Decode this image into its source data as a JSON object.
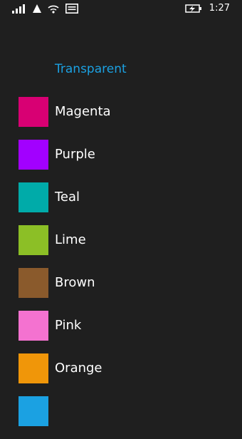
{
  "status_bar": {
    "time": "1:27",
    "icons": [
      "signal-bars-icon",
      "data-connection-icon",
      "wifi-icon",
      "message-icon",
      "battery-charging-icon"
    ]
  },
  "picker": {
    "transparent_label": "Transparent",
    "accent_color": "#1ba1e2",
    "colors": [
      {
        "label": "Magenta",
        "hex": "#d80073"
      },
      {
        "label": "Purple",
        "hex": "#a200ff"
      },
      {
        "label": "Teal",
        "hex": "#00aba9"
      },
      {
        "label": "Lime",
        "hex": "#8cbf26"
      },
      {
        "label": "Brown",
        "hex": "#8a5a2c"
      },
      {
        "label": "Pink",
        "hex": "#f472d0"
      },
      {
        "label": "Orange",
        "hex": "#f09609"
      },
      {
        "label": "",
        "hex": "#1ba1e2"
      }
    ]
  }
}
